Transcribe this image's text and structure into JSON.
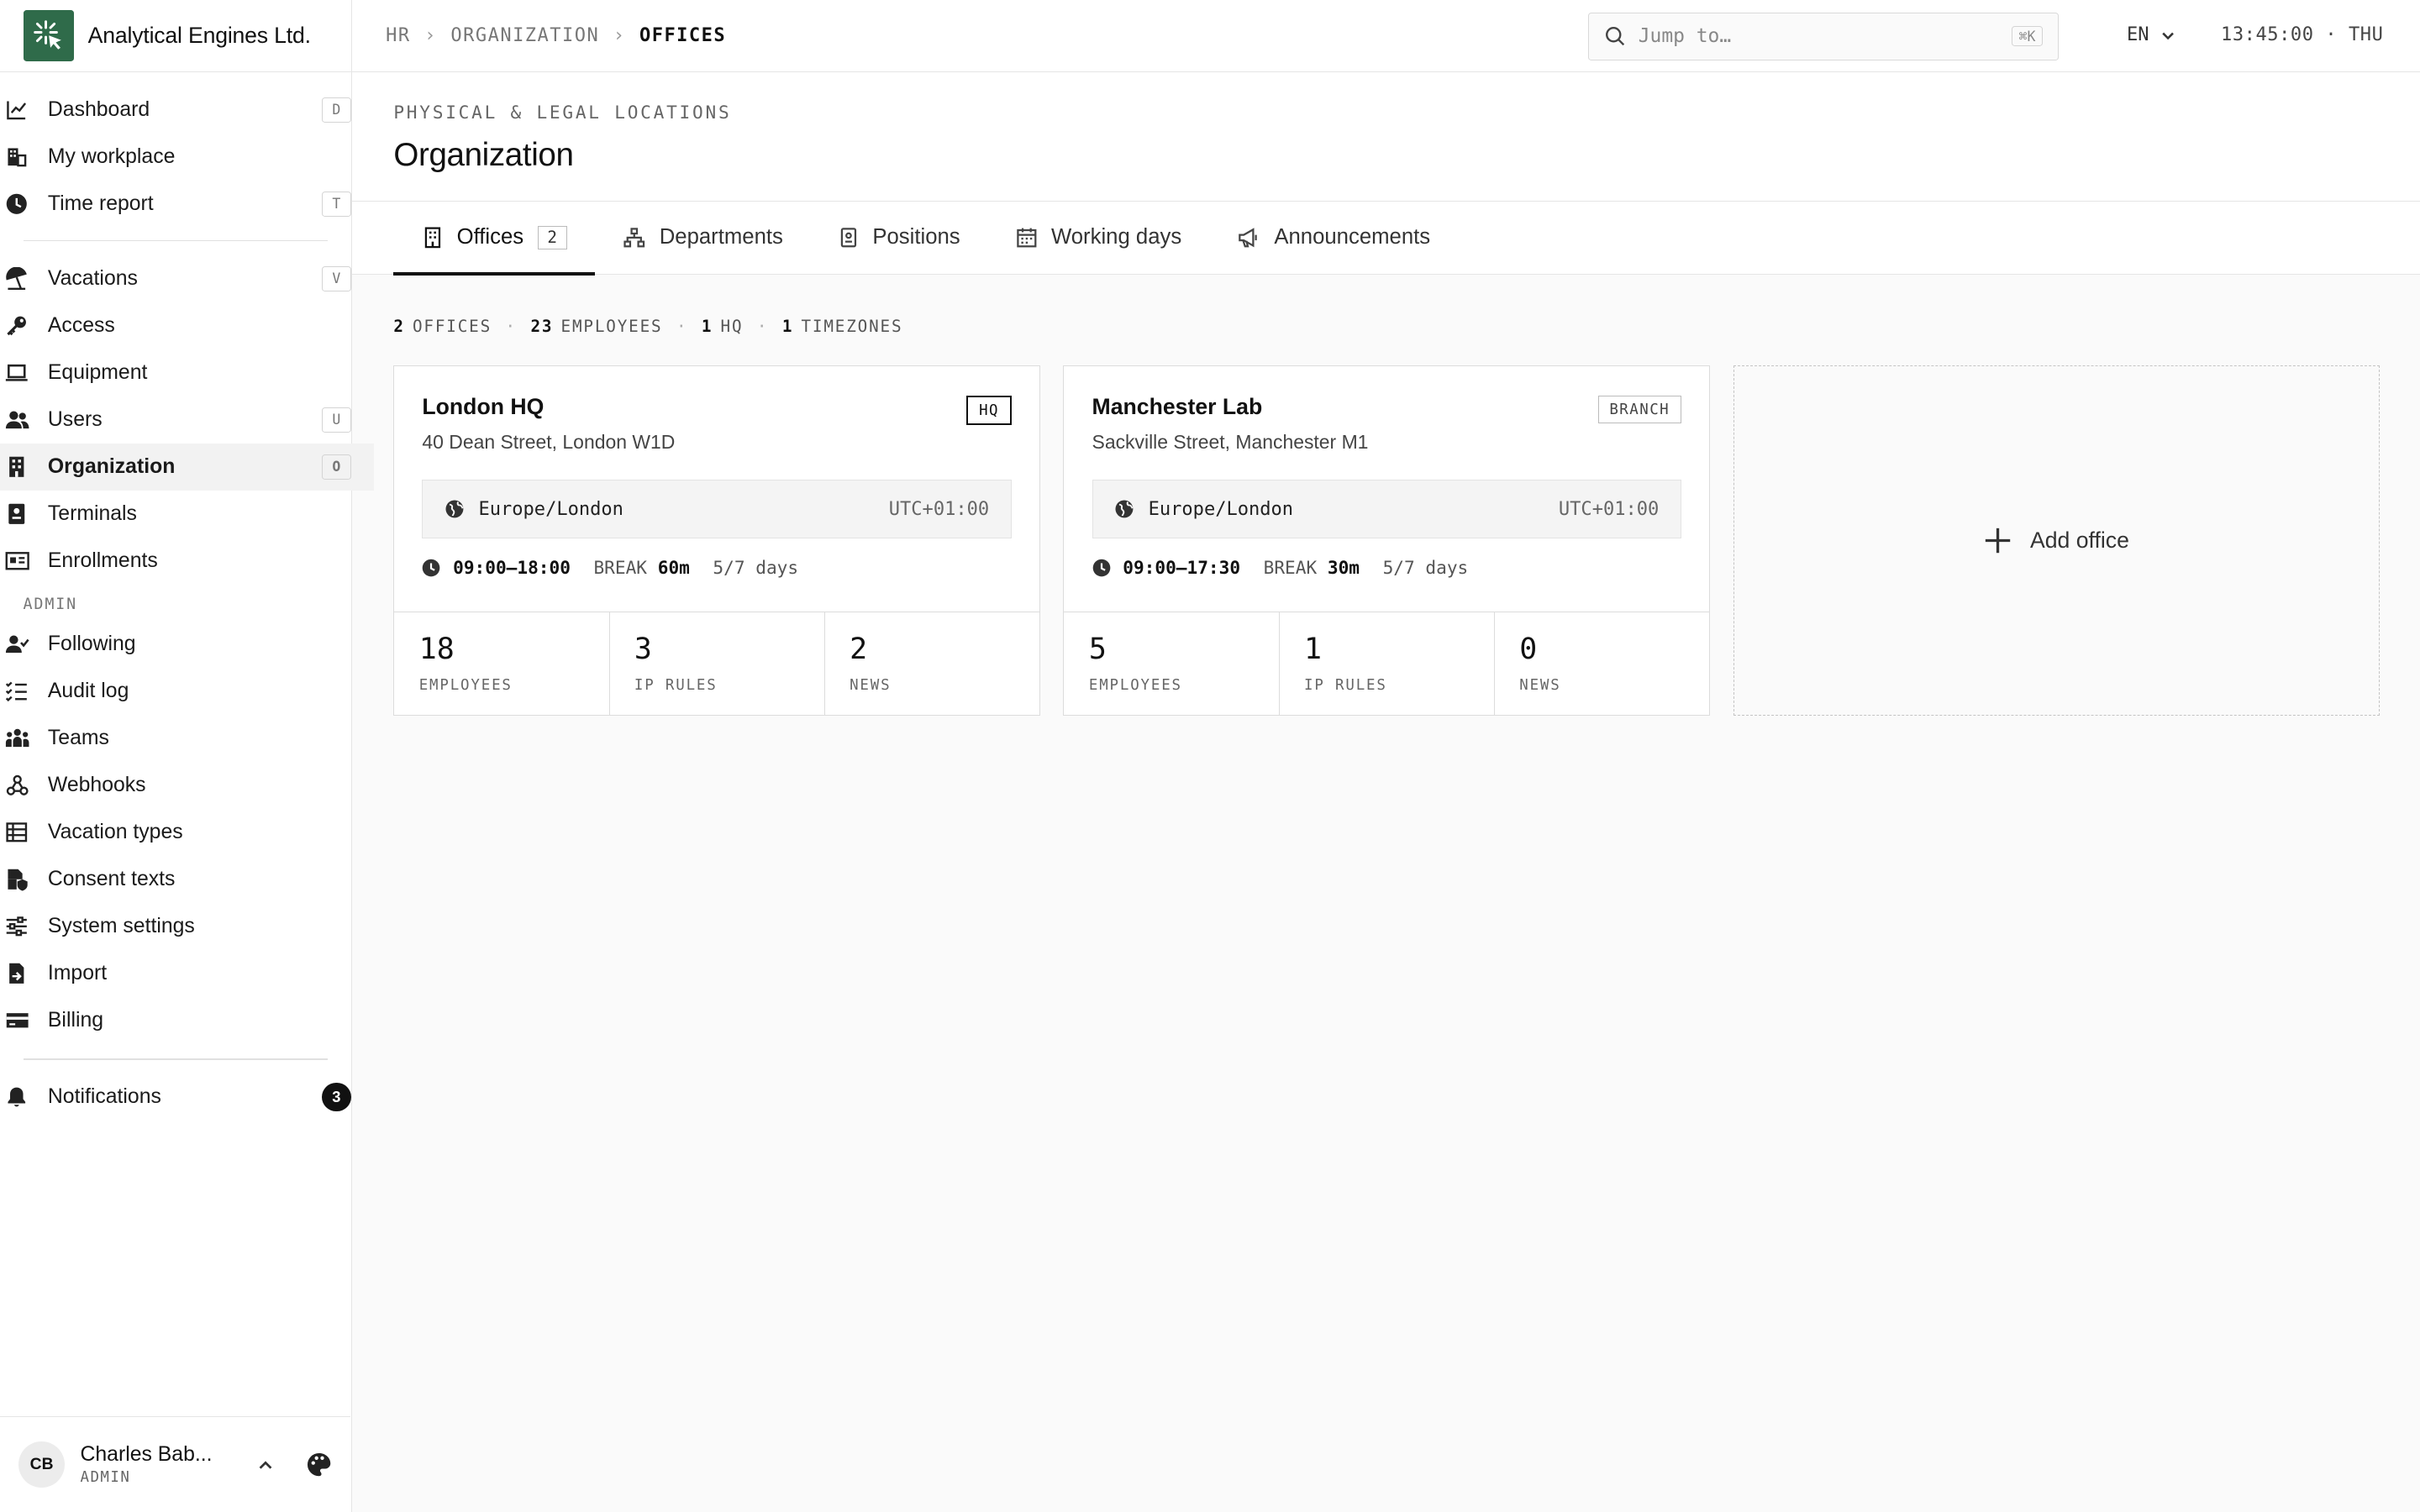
{
  "brand": {
    "name": "Analytical Engines Ltd."
  },
  "nav": {
    "main": [
      {
        "label": "Dashboard",
        "key": "D",
        "icon": "chart-line-icon"
      },
      {
        "label": "My workplace",
        "key": "",
        "icon": "workplace-icon"
      },
      {
        "label": "Time report",
        "key": "T",
        "icon": "clock-icon"
      }
    ],
    "secondary": [
      {
        "label": "Vacations",
        "key": "V",
        "icon": "umbrella-icon"
      },
      {
        "label": "Access",
        "key": "",
        "icon": "key-icon"
      },
      {
        "label": "Equipment",
        "key": "",
        "icon": "laptop-icon"
      },
      {
        "label": "Users",
        "key": "U",
        "icon": "users-icon"
      },
      {
        "label": "Organization",
        "key": "O",
        "icon": "building-icon"
      },
      {
        "label": "Terminals",
        "key": "",
        "icon": "terminal-icon"
      },
      {
        "label": "Enrollments",
        "key": "",
        "icon": "id-card-icon"
      }
    ],
    "admin_label": "ADMIN",
    "admin": [
      {
        "label": "Following",
        "icon": "user-check-icon"
      },
      {
        "label": "Audit log",
        "icon": "list-check-icon"
      },
      {
        "label": "Teams",
        "icon": "team-icon"
      },
      {
        "label": "Webhooks",
        "icon": "webhook-icon"
      },
      {
        "label": "Vacation types",
        "icon": "table-icon"
      },
      {
        "label": "Consent texts",
        "icon": "document-shield-icon"
      },
      {
        "label": "System settings",
        "icon": "sliders-icon"
      },
      {
        "label": "Import",
        "icon": "file-import-icon"
      },
      {
        "label": "Billing",
        "icon": "credit-card-icon"
      }
    ],
    "notifications": {
      "label": "Notifications",
      "count": "3"
    }
  },
  "user": {
    "initials": "CB",
    "name": "Charles Bab...",
    "role": "ADMIN"
  },
  "topbar": {
    "breadcrumb": [
      "HR",
      "ORGANIZATION",
      "OFFICES"
    ],
    "search_placeholder": "Jump to…",
    "search_kbd": "⌘K",
    "lang": "EN",
    "clock": "13:45:00 · THU"
  },
  "page": {
    "eyebrow": "PHYSICAL & LEGAL LOCATIONS",
    "title": "Organization"
  },
  "tabs": [
    {
      "label": "Offices",
      "count": "2",
      "icon": "building-icon"
    },
    {
      "label": "Departments",
      "icon": "hierarchy-icon"
    },
    {
      "label": "Positions",
      "icon": "badge-icon"
    },
    {
      "label": "Working days",
      "icon": "calendar-icon"
    },
    {
      "label": "Announcements",
      "icon": "megaphone-icon"
    }
  ],
  "summary": {
    "offices_n": "2",
    "offices_l": "OFFICES",
    "employees_n": "23",
    "employees_l": "EMPLOYEES",
    "hq_n": "1",
    "hq_l": "HQ",
    "tz_n": "1",
    "tz_l": "TIMEZONES"
  },
  "offices": [
    {
      "name": "London HQ",
      "address": "40 Dean Street, London W1D",
      "tag": "HQ",
      "timezone": "Europe/London",
      "offset": "UTC+01:00",
      "hours": "09:00–18:00",
      "break_label": "BREAK",
      "break": "60m",
      "days": "5/7 days",
      "stats": [
        {
          "value": "18",
          "label": "EMPLOYEES"
        },
        {
          "value": "3",
          "label": "IP RULES"
        },
        {
          "value": "2",
          "label": "NEWS"
        }
      ]
    },
    {
      "name": "Manchester Lab",
      "address": "Sackville Street, Manchester M1",
      "tag": "BRANCH",
      "timezone": "Europe/London",
      "offset": "UTC+01:00",
      "hours": "09:00–17:30",
      "break_label": "BREAK",
      "break": "30m",
      "days": "5/7 days",
      "stats": [
        {
          "value": "5",
          "label": "EMPLOYEES"
        },
        {
          "value": "1",
          "label": "IP RULES"
        },
        {
          "value": "0",
          "label": "NEWS"
        }
      ]
    }
  ],
  "add_office": {
    "label": "Add office"
  },
  "colors": {
    "brand": "#2f6b4a",
    "accent": "#111111"
  }
}
